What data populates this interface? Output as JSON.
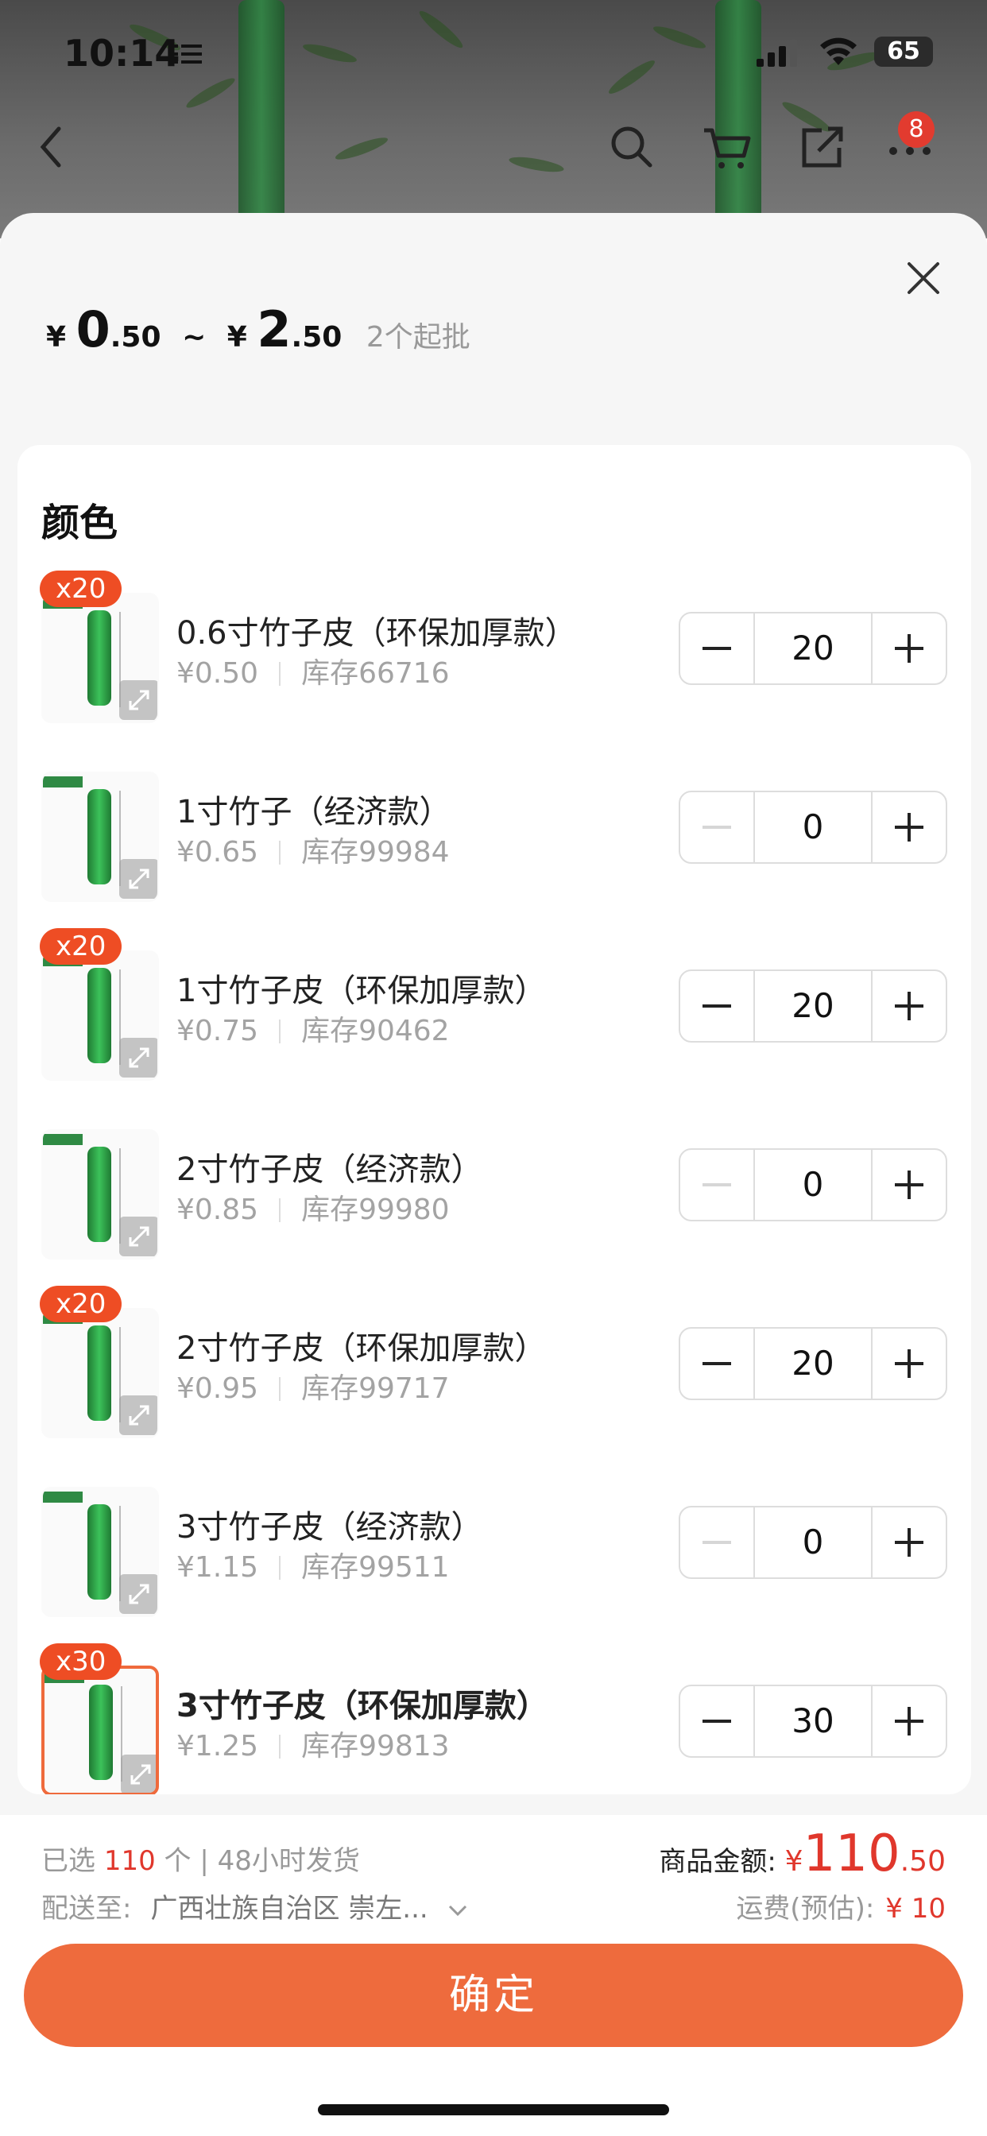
{
  "status_bar": {
    "time": "10:14",
    "battery": "65"
  },
  "top_nav": {
    "cart_badge": "8",
    "icons": [
      "back-icon",
      "search-icon",
      "cart-icon",
      "share-icon",
      "more-icon"
    ]
  },
  "sheet": {
    "price": {
      "symbol1": "¥",
      "min_int": "0",
      "min_dec": ".50",
      "tilde": "~",
      "symbol2": "¥",
      "max_int": "2",
      "max_dec": ".50",
      "moq": "2个起批"
    },
    "section_title": "颜色",
    "variants": [
      {
        "qty_badge": "x20",
        "name": "0.6寸竹子皮（环保加厚款）",
        "price": "¥0.50",
        "stock": "库存66716",
        "qty": "20",
        "selected": false
      },
      {
        "qty_badge": "",
        "name": "1寸竹子（经济款）",
        "price": "¥0.65",
        "stock": "库存99984",
        "qty": "0",
        "selected": false
      },
      {
        "qty_badge": "x20",
        "name": "1寸竹子皮（环保加厚款）",
        "price": "¥0.75",
        "stock": "库存90462",
        "qty": "20",
        "selected": false
      },
      {
        "qty_badge": "",
        "name": "2寸竹子皮（经济款）",
        "price": "¥0.85",
        "stock": "库存99980",
        "qty": "0",
        "selected": false
      },
      {
        "qty_badge": "x20",
        "name": "2寸竹子皮（环保加厚款）",
        "price": "¥0.95",
        "stock": "库存99717",
        "qty": "20",
        "selected": false
      },
      {
        "qty_badge": "",
        "name": "3寸竹子皮（经济款）",
        "price": "¥1.15",
        "stock": "库存99511",
        "qty": "0",
        "selected": false
      },
      {
        "qty_badge": "x30",
        "name": "3寸竹子皮（环保加厚款）",
        "price": "¥1.25",
        "stock": "库存99813",
        "qty": "30",
        "selected": true
      }
    ]
  },
  "summary": {
    "selected_prefix": "已选",
    "selected_count": "110",
    "selected_suffix": "个 | 48小时发货",
    "ship_label": "配送至:",
    "ship_address": "广西壮族自治区 崇左...",
    "amount_label": "商品金额:",
    "amount_symbol": "¥",
    "amount_int": "110",
    "amount_dec": ".50",
    "fee_label": "运费(预估):",
    "fee_value": "¥ 10",
    "confirm_label": "确定"
  },
  "colors": {
    "accent": "#EE6B3D",
    "badge": "#EE4D24",
    "price_red": "#E0372C"
  }
}
